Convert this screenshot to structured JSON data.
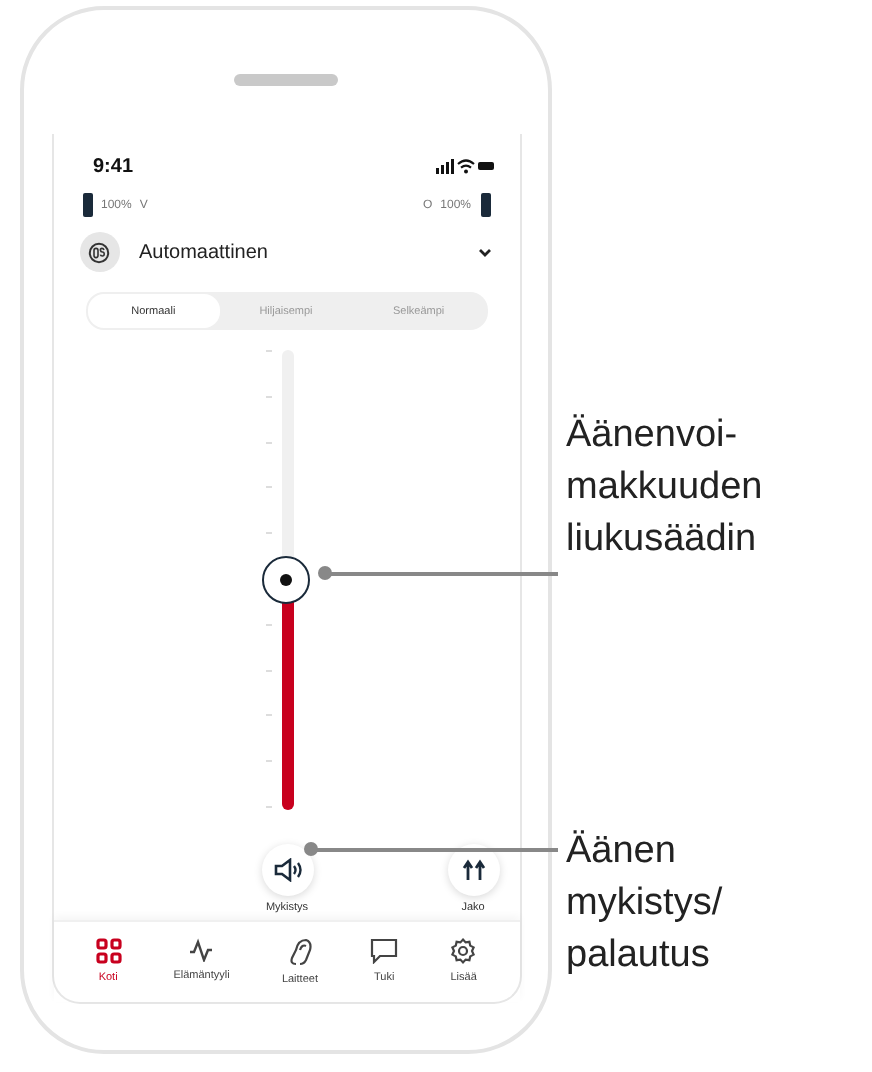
{
  "status_bar": {
    "time": "9:41"
  },
  "hearing_aids": {
    "left": {
      "battery": "100%",
      "side": "V"
    },
    "right": {
      "side": "O",
      "battery": "100%"
    }
  },
  "program": {
    "name": "Automaattinen"
  },
  "sound_modes": [
    {
      "label": "Normaali",
      "selected": true
    },
    {
      "label": "Hiljaisempi",
      "selected": false
    },
    {
      "label": "Selkeämpi",
      "selected": false
    }
  ],
  "volume_slider": {
    "level": 0.51
  },
  "actions": [
    {
      "kind": "mute",
      "label": "Mykistys"
    },
    {
      "kind": "split",
      "label": "Jako"
    }
  ],
  "nav": [
    {
      "kind": "home",
      "label": "Koti",
      "selected": true
    },
    {
      "kind": "lifestyle",
      "label": "Elämäntyyli",
      "selected": false
    },
    {
      "kind": "devices",
      "label": "Laitteet",
      "selected": false
    },
    {
      "kind": "support",
      "label": "Tuki",
      "selected": false
    },
    {
      "kind": "more",
      "label": "Lisää",
      "selected": false
    }
  ],
  "callouts": [
    {
      "kind": "slider",
      "lines": [
        "Äänenvoi-",
        "makkuuden",
        "liukusäädin"
      ]
    },
    {
      "kind": "mute",
      "lines": [
        "Äänen",
        "mykistys/",
        "palautus"
      ]
    }
  ]
}
